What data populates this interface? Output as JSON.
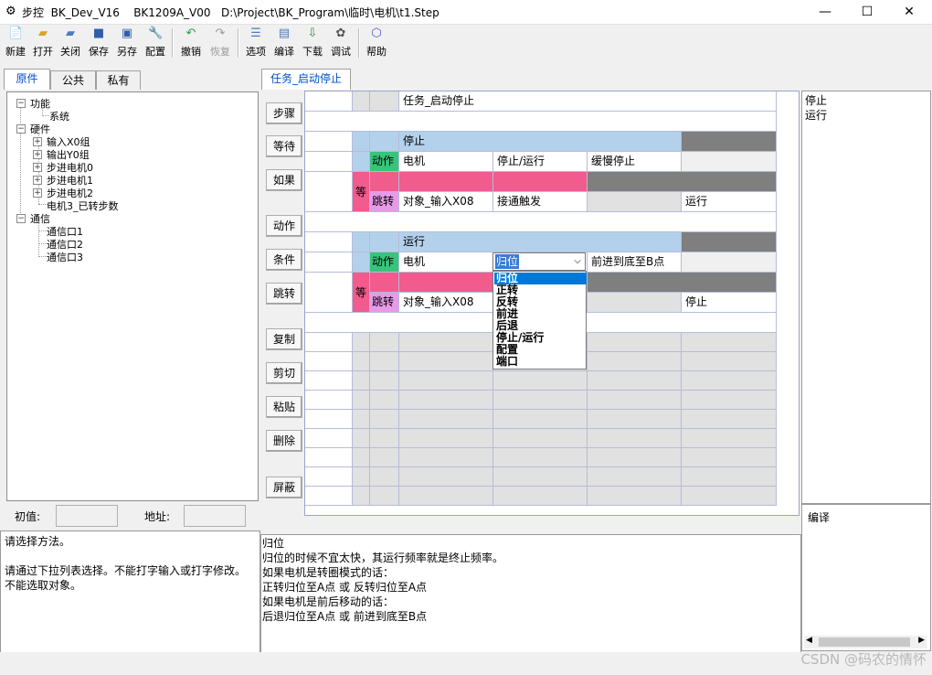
{
  "window": {
    "title": "步控  BK_Dev_V16    BK1209A_V00   D:\\Project\\BK_Program\\临时\\电机\\t1.Step",
    "minimize": "—",
    "maximize": "☐",
    "close": "✕"
  },
  "toolbar": [
    {
      "label": "新建",
      "icon": "new-file-icon"
    },
    {
      "label": "打开",
      "icon": "open-folder-icon"
    },
    {
      "label": "关闭",
      "icon": "close-folder-icon"
    },
    {
      "label": "保存",
      "icon": "save-icon"
    },
    {
      "label": "另存",
      "icon": "save-as-icon"
    },
    {
      "label": "配置",
      "icon": "wrench-icon"
    },
    {
      "label": "撤销",
      "icon": "undo-icon"
    },
    {
      "label": "恢复",
      "icon": "redo-icon",
      "disabled": true
    },
    {
      "label": "选项",
      "icon": "options-icon"
    },
    {
      "label": "编译",
      "icon": "compile-icon"
    },
    {
      "label": "下载",
      "icon": "download-icon"
    },
    {
      "label": "调试",
      "icon": "debug-icon"
    },
    {
      "label": "帮助",
      "icon": "help-icon"
    }
  ],
  "left_tabs": [
    "原件",
    "公共",
    "私有"
  ],
  "tree": {
    "nodes": [
      "功能",
      "系统",
      "硬件",
      "输入X0组",
      "输出Y0组",
      "步进电机0",
      "步进电机1",
      "步进电机2",
      "电机3_已转步数",
      "通信",
      "通信口1",
      "通信口2",
      "通信口3"
    ]
  },
  "fields": {
    "initial_label": "初值:",
    "address_label": "地址:"
  },
  "task_tab": "任务_启动停止",
  "side_buttons": [
    "步骤",
    "等待",
    "如果",
    "动作",
    "条件",
    "跳转",
    "复制",
    "剪切",
    "粘贴",
    "删除",
    "屏蔽"
  ],
  "grid": {
    "task_name": "任务_启动停止",
    "step1": {
      "name": "停止",
      "action": "动作",
      "target": "电机",
      "mode": "停止/运行",
      "param": "缓慢停止",
      "wait": "等",
      "jump": "跳转",
      "jump_obj": "对象_输入X08",
      "jump_cond": "接通触发",
      "jump_dest": "运行"
    },
    "step2": {
      "name": "运行",
      "action": "动作",
      "target": "电机",
      "mode": "归位",
      "param": "前进到底至B点",
      "wait": "等",
      "jump": "跳转",
      "jump_obj": "对象_输入X08",
      "jump_dest": "停止"
    }
  },
  "dropdown": {
    "current": "归位",
    "options": [
      "归位",
      "正转",
      "反转",
      "前进",
      "后退",
      "停止/运行",
      "配置",
      "端口"
    ]
  },
  "right_panel_top": [
    "停止",
    "运行"
  ],
  "right_panel_bottom": "编译",
  "bottom_left": [
    "请选择方法。",
    "",
    "请通过下拉列表选择。不能打字输入或打字修改。",
    "不能选取对象。"
  ],
  "bottom_mid": [
    "归位",
    "归位的时候不宜太快，其运行频率就是终止频率。",
    "如果电机是转圈模式的话：",
    "正转归位至A点 或 反转归位至A点",
    "如果电机是前后移动的话：",
    "后退归位至A点 或 前进到底至B点"
  ],
  "watermark": "CSDN @码农的情怀",
  "colors": {
    "blue_header": "#b4d1ec",
    "dark": "#7f7f7f",
    "pink": "#f25b8d",
    "green": "#38c47a",
    "violet": "#e89ae8",
    "accent": "#0078d7"
  }
}
